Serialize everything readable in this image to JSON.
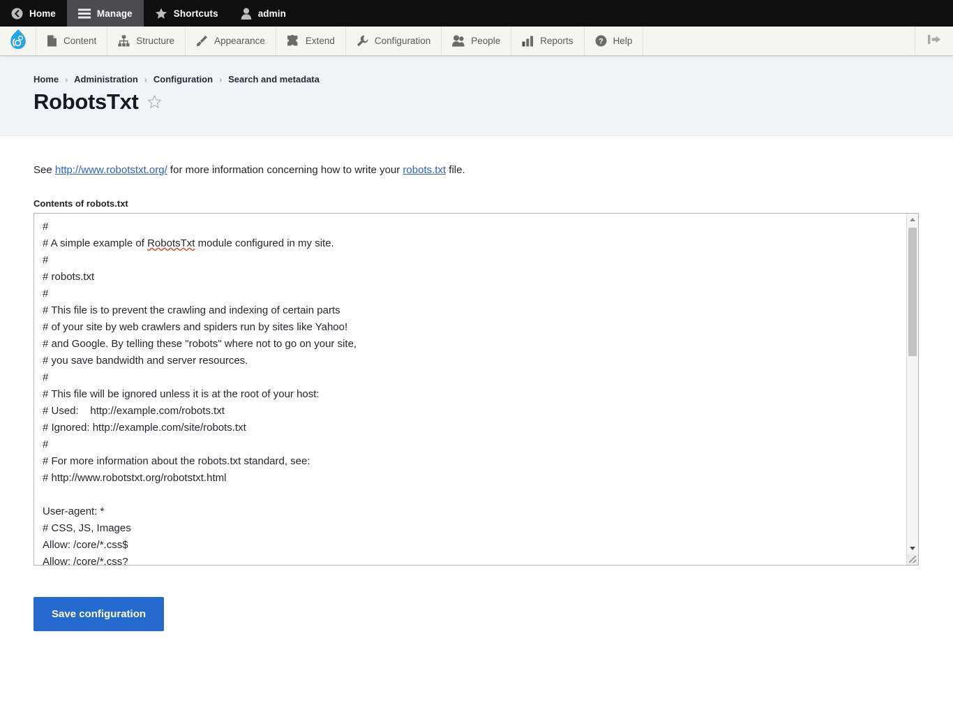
{
  "toolbar_top": {
    "items": [
      {
        "label": "Home",
        "icon": "home-back-icon",
        "active": false
      },
      {
        "label": "Manage",
        "icon": "hamburger-icon",
        "active": true
      },
      {
        "label": "Shortcuts",
        "icon": "star-icon",
        "active": false
      },
      {
        "label": "admin",
        "icon": "user-icon",
        "active": false
      }
    ]
  },
  "toolbar_admin": {
    "logo_icon": "drupal-drop-logo",
    "toggle_icon": "toolbar-orientation-toggle-icon",
    "items": [
      {
        "label": "Content",
        "icon": "file-icon"
      },
      {
        "label": "Structure",
        "icon": "sitemap-icon"
      },
      {
        "label": "Appearance",
        "icon": "paintbrush-icon"
      },
      {
        "label": "Extend",
        "icon": "puzzle-piece-icon"
      },
      {
        "label": "Configuration",
        "icon": "wrench-icon"
      },
      {
        "label": "People",
        "icon": "people-icon"
      },
      {
        "label": "Reports",
        "icon": "bar-chart-icon"
      },
      {
        "label": "Help",
        "icon": "question-circle-icon"
      }
    ]
  },
  "header": {
    "breadcrumb": [
      "Home",
      "Administration",
      "Configuration",
      "Search and metadata"
    ],
    "breadcrumb_separator": "›",
    "title": "RobotsTxt",
    "shortcut_icon": "star-outline-icon"
  },
  "main": {
    "intro": {
      "prefix": "See ",
      "link_url_text": "http://www.robotstxt.org/",
      "middle": " for more information concerning how to write your ",
      "link_file_text": "robots.txt",
      "suffix": " file."
    },
    "field": {
      "label": "Contents of robots.txt",
      "lines": [
        "#",
        "# A simple example of RobotsTxt module configured in my site.",
        "#",
        "# robots.txt",
        "#",
        "# This file is to prevent the crawling and indexing of certain parts",
        "# of your site by web crawlers and spiders run by sites like Yahoo!",
        "# and Google. By telling these \"robots\" where not to go on your site,",
        "# you save bandwidth and server resources.",
        "#",
        "# This file will be ignored unless it is at the root of your host:",
        "# Used:    http://example.com/robots.txt",
        "# Ignored: http://example.com/site/robots.txt",
        "#",
        "# For more information about the robots.txt standard, see:",
        "# http://www.robotstxt.org/robotstxt.html",
        "",
        "User-agent: *",
        "# CSS, JS, Images",
        "Allow: /core/*.css$",
        "Allow: /core/*.css?"
      ],
      "selected_line_index": 1,
      "misspelled_word": "RobotsTxt"
    },
    "save_label": "Save configuration"
  },
  "colors": {
    "toolbar_top_bg": "#0f0f10",
    "toolbar_top_active_bg": "#4b4b4f",
    "toolbar_admin_bg": "#f5f5f2",
    "page_header_bg": "#f2f3f7",
    "link": "#2b60c8",
    "primary_button": "#2369ce",
    "selection_highlight": "#e3e3e3",
    "spellcheck_underline": "#d64b2a",
    "drupal_blue": "#29a5dd"
  }
}
